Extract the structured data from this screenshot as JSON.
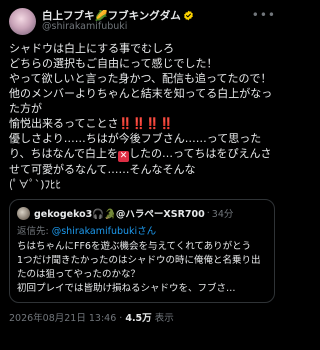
{
  "author": {
    "display_name": "白上フブキ🌽フブキングダム",
    "handle": "@shirakamifubuki"
  },
  "post": {
    "line1": "シャドウは白上にする事でむしろ",
    "line2": "どちらの選択もご自由にって感じでした！",
    "line3": "やって欲しいと言った身かつ、配信も追ってたので！",
    "line4": "他のメンバーよりちゃんと結末を知ってる白上がなった方が",
    "line5": "愉悦出来るってことさ",
    "marks": "‼️‼️‼️‼️",
    "line6": "優しさより……ちはが今後フブさん……って思ったり、ちはなんで白上を",
    "cross": "✕",
    "line7": "したの…ってちはをぴえんさせて可愛がるなんて……そんなそんな",
    "line8": "(ﾟ∀ﾟ`)ﾌﾋﾋ"
  },
  "quote": {
    "display_name": "gekogeko3🎧🐊@ハラペーXSR700",
    "dot": "·",
    "time": "34分",
    "reply_prefix": "返信先: ",
    "reply_to": "@shirakamifubukiさん",
    "text": "ちはちゃんにFF6を遊ぶ機会を与えてくれてありがとう\n1つだけ聞きたかったのはシャドウの時に俺俺と名乗り出たのは狙ってやったのかな？\n初回プレイでは皆助け損ねるシャドウを、フブさ…"
  },
  "meta": {
    "timestamp": "2026年08月21日 13:46",
    "sep": " · ",
    "views_count": "4.5万",
    "views_label": " 表示"
  },
  "colors": {
    "background": "#000000",
    "text": "#e7e9ea",
    "secondary": "#71767b",
    "accent": "#1d9bf0",
    "verified": "#ffd400"
  },
  "icons": [
    "verified-badge-icon",
    "more-options-icon",
    "cross-mark-icon"
  ]
}
